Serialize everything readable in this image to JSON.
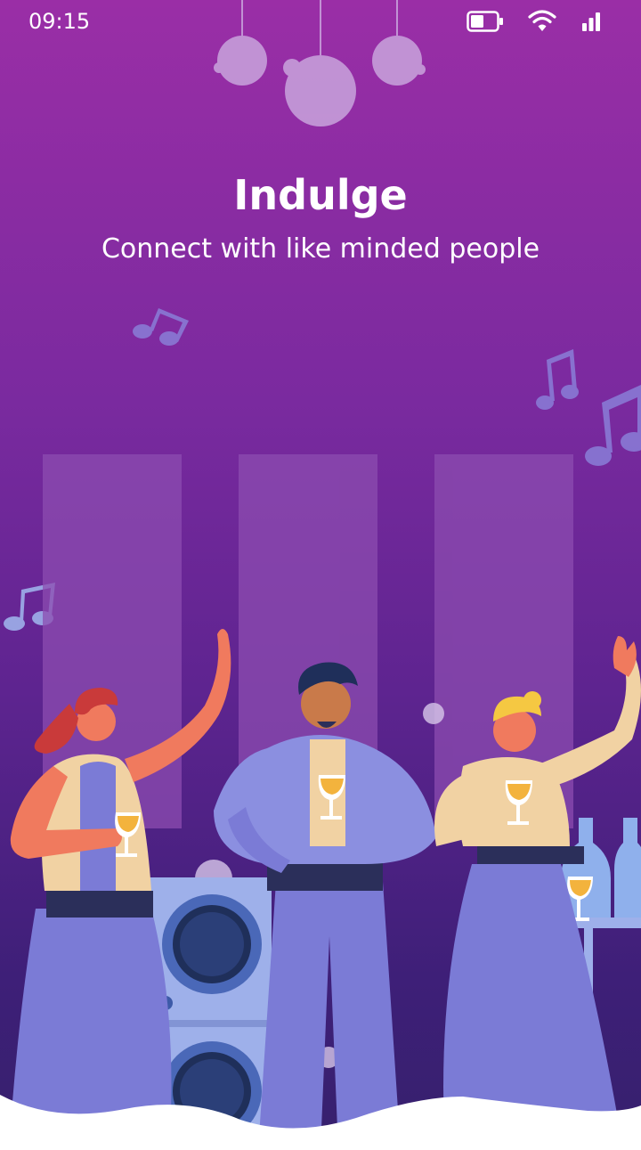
{
  "status_bar": {
    "time": "09:15",
    "icons": [
      "battery-icon",
      "wifi-icon",
      "signal-icon"
    ]
  },
  "hero": {
    "title": "Indulge",
    "subtitle": "Connect with like minded people"
  },
  "colors": {
    "background_top": "#9a2ea6",
    "background_bottom": "#36206d",
    "accent_purple": "#7b7bd6",
    "skin_coral": "#f07a5e",
    "beige": "#f1d2a3",
    "white": "#ffffff"
  }
}
